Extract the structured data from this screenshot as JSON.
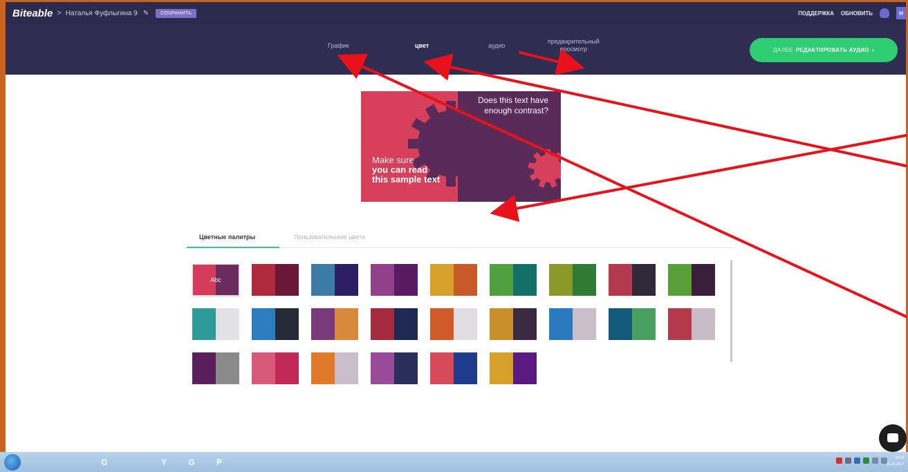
{
  "app": {
    "logo": "Biteable",
    "breadcrumb_sep": ">",
    "project_name": "Наталья Фуфлыгина 9",
    "edit_icon": "pencil-icon",
    "save_label": "СОХРАНИТЬ"
  },
  "header_right": {
    "support_label": "ПОДДЕРЖКА",
    "upgrade_label": "ОБНОВИТЬ",
    "avatar_letter": "Н"
  },
  "nav": {
    "tabs": [
      {
        "label": "График",
        "active": false
      },
      {
        "label": "цвет",
        "active": true
      },
      {
        "label": "аудио",
        "active": false
      },
      {
        "label": "предварительный",
        "label2": "просмотр",
        "active": false
      }
    ],
    "next_button": {
      "prefix": "ДАЛЕЕ",
      "label": "РЕДАКТИРОВАТЬ АУДИО",
      "chevron": "›"
    }
  },
  "preview": {
    "question": "Does this text have enough contrast?",
    "line1": "Make sure",
    "line2": "you can read",
    "line3": "this sample text",
    "colors": {
      "left": "#d7405a",
      "right": "#5a2a59"
    }
  },
  "palette_tabs": {
    "active": "Цветные палитры",
    "inactive": "Пользовательские цвета",
    "accent": "#36c889"
  },
  "palettes": [
    {
      "a": "#d63a5a",
      "b": "#6a2b5e",
      "label": "Abc",
      "selected": true
    },
    {
      "a": "#b02a3e",
      "b": "#6a1838"
    },
    {
      "a": "#3c7aa8",
      "b": "#2c1e62"
    },
    {
      "a": "#92408a",
      "b": "#5a1a62"
    },
    {
      "a": "#d6a02a",
      "b": "#c85a2a"
    },
    {
      "a": "#4fa040",
      "b": "#137068"
    },
    {
      "a": "#8a9a2a",
      "b": "#2f7a34"
    },
    {
      "a": "#b23a4c",
      "b": "#2e2a3a"
    },
    {
      "a": "#5aa03a",
      "b": "#3a1e3a"
    },
    {
      "a": "#2f9a9a",
      "b": "#e2e2e6"
    },
    {
      "a": "#2a7ec0",
      "b": "#262a36"
    },
    {
      "a": "#7a3a7a",
      "b": "#d88a3a"
    },
    {
      "a": "#a62a3e",
      "b": "#1e2a52"
    },
    {
      "a": "#d05a2a",
      "b": "#e0dce0"
    },
    {
      "a": "#c8902a",
      "b": "#3a2a42"
    },
    {
      "a": "#2a7ac0",
      "b": "#cabcc8"
    },
    {
      "a": "#145a7a",
      "b": "#4aa060"
    },
    {
      "a": "#b23a4a",
      "b": "#cabcc6"
    },
    {
      "a": "#5a1e5a",
      "b": "#8a8a8a"
    },
    {
      "a": "#d85a78",
      "b": "#c02a5a"
    },
    {
      "a": "#e07a2a",
      "b": "#cabcc8"
    },
    {
      "a": "#9a4a9a",
      "b": "#2a2e5a"
    },
    {
      "a": "#d84a5a",
      "b": "#1e3a8a"
    },
    {
      "a": "#d6a02a",
      "b": "#5a1a82"
    }
  ],
  "icons": {
    "chat": "chat-icon",
    "start": "windows-start-icon"
  },
  "taskbar": {
    "apps": [
      {
        "name": "explorer-icon",
        "glyph": "",
        "color": "#e8c55a"
      },
      {
        "name": "folder-icon",
        "glyph": "",
        "color": "#e8c55a"
      },
      {
        "name": "chrome-icon",
        "glyph": "G",
        "color": "#d84030"
      },
      {
        "name": "save-floppy-icon",
        "glyph": "",
        "color": "#3a5aa8"
      },
      {
        "name": "yandex-icon",
        "glyph": "Y",
        "color": "#e04040"
      },
      {
        "name": "chrome-icon-2",
        "glyph": "G",
        "color": "#2c9a4a"
      },
      {
        "name": "powerpoint-icon",
        "glyph": "P",
        "color": "#d86a2a"
      }
    ],
    "clock_time": "19:34",
    "clock_date": "26.10.2017"
  },
  "annotation_color": "#e8121a"
}
